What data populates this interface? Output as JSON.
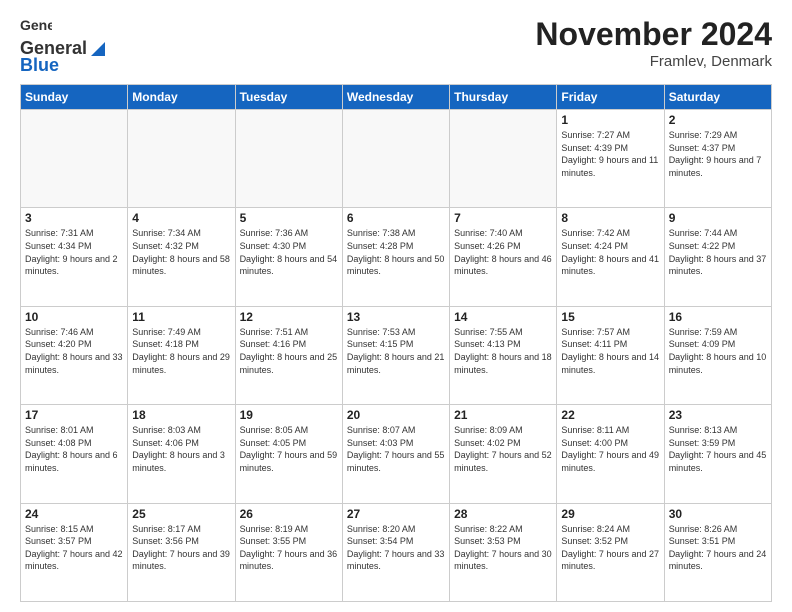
{
  "logo": {
    "text_general": "General",
    "text_blue": "Blue"
  },
  "header": {
    "month_title": "November 2024",
    "location": "Framlev, Denmark"
  },
  "weekdays": [
    "Sunday",
    "Monday",
    "Tuesday",
    "Wednesday",
    "Thursday",
    "Friday",
    "Saturday"
  ],
  "weeks": [
    [
      {
        "day": "",
        "empty": true
      },
      {
        "day": "",
        "empty": true
      },
      {
        "day": "",
        "empty": true
      },
      {
        "day": "",
        "empty": true
      },
      {
        "day": "",
        "empty": true
      },
      {
        "day": "1",
        "sunrise": "7:27 AM",
        "sunset": "4:39 PM",
        "daylight": "9 hours and 11 minutes."
      },
      {
        "day": "2",
        "sunrise": "7:29 AM",
        "sunset": "4:37 PM",
        "daylight": "9 hours and 7 minutes."
      }
    ],
    [
      {
        "day": "3",
        "sunrise": "7:31 AM",
        "sunset": "4:34 PM",
        "daylight": "9 hours and 2 minutes."
      },
      {
        "day": "4",
        "sunrise": "7:34 AM",
        "sunset": "4:32 PM",
        "daylight": "8 hours and 58 minutes."
      },
      {
        "day": "5",
        "sunrise": "7:36 AM",
        "sunset": "4:30 PM",
        "daylight": "8 hours and 54 minutes."
      },
      {
        "day": "6",
        "sunrise": "7:38 AM",
        "sunset": "4:28 PM",
        "daylight": "8 hours and 50 minutes."
      },
      {
        "day": "7",
        "sunrise": "7:40 AM",
        "sunset": "4:26 PM",
        "daylight": "8 hours and 46 minutes."
      },
      {
        "day": "8",
        "sunrise": "7:42 AM",
        "sunset": "4:24 PM",
        "daylight": "8 hours and 41 minutes."
      },
      {
        "day": "9",
        "sunrise": "7:44 AM",
        "sunset": "4:22 PM",
        "daylight": "8 hours and 37 minutes."
      }
    ],
    [
      {
        "day": "10",
        "sunrise": "7:46 AM",
        "sunset": "4:20 PM",
        "daylight": "8 hours and 33 minutes."
      },
      {
        "day": "11",
        "sunrise": "7:49 AM",
        "sunset": "4:18 PM",
        "daylight": "8 hours and 29 minutes."
      },
      {
        "day": "12",
        "sunrise": "7:51 AM",
        "sunset": "4:16 PM",
        "daylight": "8 hours and 25 minutes."
      },
      {
        "day": "13",
        "sunrise": "7:53 AM",
        "sunset": "4:15 PM",
        "daylight": "8 hours and 21 minutes."
      },
      {
        "day": "14",
        "sunrise": "7:55 AM",
        "sunset": "4:13 PM",
        "daylight": "8 hours and 18 minutes."
      },
      {
        "day": "15",
        "sunrise": "7:57 AM",
        "sunset": "4:11 PM",
        "daylight": "8 hours and 14 minutes."
      },
      {
        "day": "16",
        "sunrise": "7:59 AM",
        "sunset": "4:09 PM",
        "daylight": "8 hours and 10 minutes."
      }
    ],
    [
      {
        "day": "17",
        "sunrise": "8:01 AM",
        "sunset": "4:08 PM",
        "daylight": "8 hours and 6 minutes."
      },
      {
        "day": "18",
        "sunrise": "8:03 AM",
        "sunset": "4:06 PM",
        "daylight": "8 hours and 3 minutes."
      },
      {
        "day": "19",
        "sunrise": "8:05 AM",
        "sunset": "4:05 PM",
        "daylight": "7 hours and 59 minutes."
      },
      {
        "day": "20",
        "sunrise": "8:07 AM",
        "sunset": "4:03 PM",
        "daylight": "7 hours and 55 minutes."
      },
      {
        "day": "21",
        "sunrise": "8:09 AM",
        "sunset": "4:02 PM",
        "daylight": "7 hours and 52 minutes."
      },
      {
        "day": "22",
        "sunrise": "8:11 AM",
        "sunset": "4:00 PM",
        "daylight": "7 hours and 49 minutes."
      },
      {
        "day": "23",
        "sunrise": "8:13 AM",
        "sunset": "3:59 PM",
        "daylight": "7 hours and 45 minutes."
      }
    ],
    [
      {
        "day": "24",
        "sunrise": "8:15 AM",
        "sunset": "3:57 PM",
        "daylight": "7 hours and 42 minutes."
      },
      {
        "day": "25",
        "sunrise": "8:17 AM",
        "sunset": "3:56 PM",
        "daylight": "7 hours and 39 minutes."
      },
      {
        "day": "26",
        "sunrise": "8:19 AM",
        "sunset": "3:55 PM",
        "daylight": "7 hours and 36 minutes."
      },
      {
        "day": "27",
        "sunrise": "8:20 AM",
        "sunset": "3:54 PM",
        "daylight": "7 hours and 33 minutes."
      },
      {
        "day": "28",
        "sunrise": "8:22 AM",
        "sunset": "3:53 PM",
        "daylight": "7 hours and 30 minutes."
      },
      {
        "day": "29",
        "sunrise": "8:24 AM",
        "sunset": "3:52 PM",
        "daylight": "7 hours and 27 minutes."
      },
      {
        "day": "30",
        "sunrise": "8:26 AM",
        "sunset": "3:51 PM",
        "daylight": "7 hours and 24 minutes."
      }
    ]
  ]
}
